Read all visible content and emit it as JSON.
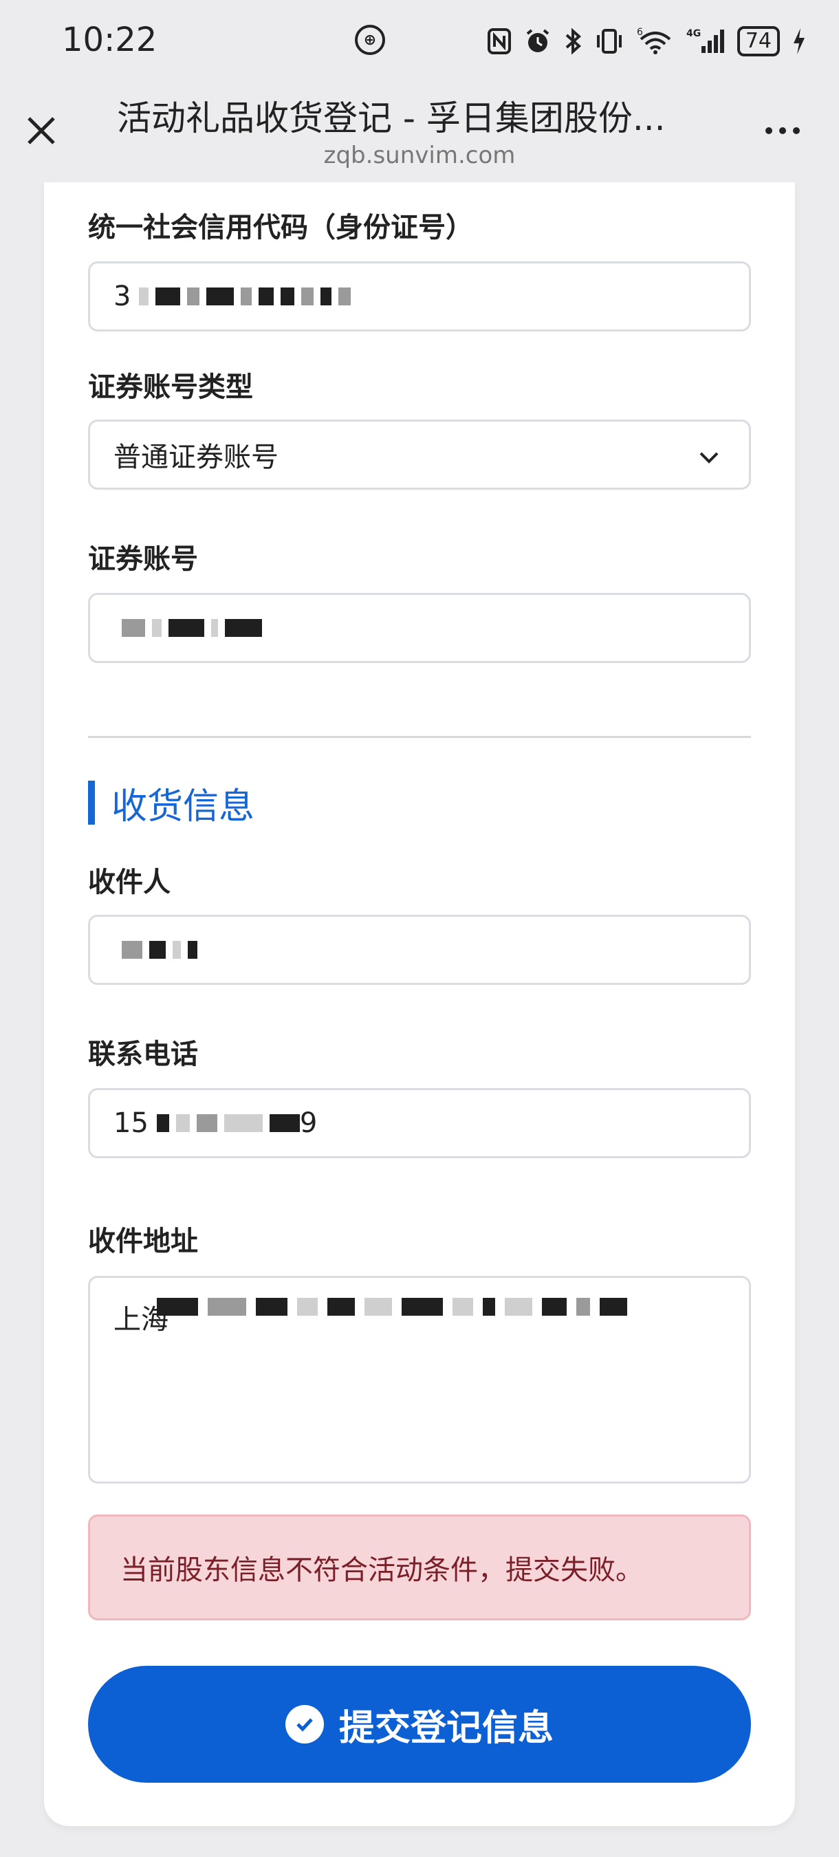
{
  "status_bar": {
    "time": "10:22",
    "battery": "74",
    "network": "4G",
    "wifi_badge": "6"
  },
  "browser": {
    "title": "活动礼品收货登记 - 孚日集团股份...",
    "domain": "zqb.sunvim.com"
  },
  "form": {
    "credit_code": {
      "label": "统一社会信用代码（身份证号）",
      "value_prefix": "3"
    },
    "account_type": {
      "label": "证券账号类型",
      "selected": "普通证券账号"
    },
    "account_number": {
      "label": "证券账号",
      "value_prefix": ""
    }
  },
  "shipping": {
    "section_title": "收货信息",
    "recipient": {
      "label": "收件人",
      "value_prefix": ""
    },
    "phone": {
      "label": "联系电话",
      "value_prefix": "15",
      "value_suffix": "9"
    },
    "address": {
      "label": "收件地址",
      "value_prefix": "上海"
    }
  },
  "error_message": "当前股东信息不符合活动条件，提交失败。",
  "submit_label": "提交登记信息",
  "colors": {
    "accent": "#1766d6",
    "button": "#0d5fd4",
    "error_bg": "#f7d6da",
    "error_text": "#7a1e28"
  }
}
